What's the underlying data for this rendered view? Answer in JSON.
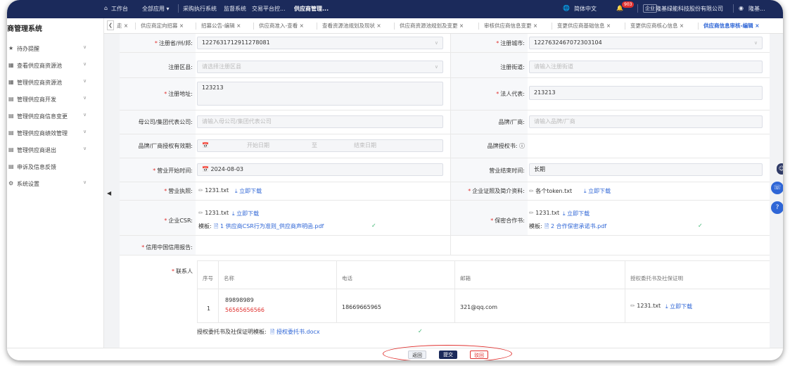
{
  "topbar": {
    "workbench": "工作台",
    "all_apps": "全部应用 ▾",
    "links": [
      "采购执行系统",
      "监督系统",
      "交易平台控...",
      "供应商管理..."
    ],
    "language": "简体中文",
    "notif_count": "903",
    "enterprise_tag": "企业",
    "company": "隆基绿能科技股份有限公司",
    "user": "隆基..."
  },
  "sidebar": {
    "system_title": "商管理系统",
    "items": [
      {
        "icon": "待",
        "label": "待办提醒"
      },
      {
        "icon": "查",
        "label": "查看供应商资源池"
      },
      {
        "icon": "管",
        "label": "管理供应商资源池"
      },
      {
        "icon": "开",
        "label": "管理供应商开发"
      },
      {
        "icon": "变",
        "label": "管理供应商信息变更"
      },
      {
        "icon": "绩",
        "label": "管理供应商绩效管理"
      },
      {
        "icon": "退",
        "label": "管理供应商退出"
      },
      {
        "icon": "诉",
        "label": "申诉及信息反馈"
      },
      {
        "icon": "设",
        "label": "系统设置"
      }
    ]
  },
  "tabs": [
    "走 ×",
    "供应商定向招募 ×",
    "招募公告-编辑 ×",
    "供应商准入-查看 ×",
    "查看资源池规划及现状 ×",
    "供应商资源池规划及变更 ×",
    "审核供应商信息变更 ×",
    "变更供应商基础信息 ×",
    "变更供应商核心信息 ×",
    "供应商信息审核-编辑 ×"
  ],
  "form": {
    "reg_province_label": "注册省/州/邦:",
    "reg_province_value": "1227631712911278081",
    "reg_city_label": "注册城市:",
    "reg_city_value": "1227632467072303104",
    "reg_district_label": "注册区县:",
    "reg_district_placeholder": "请选择注册区县",
    "reg_street_label": "注册街道:",
    "reg_street_placeholder": "请输入注册街道",
    "reg_address_label": "注册地址:",
    "reg_address_value": "123213",
    "legal_rep_label": "法人代表:",
    "legal_rep_value": "213213",
    "parent_rep_label": "母公司/集团代表公司:",
    "parent_rep_placeholder": "请输入母公司/集团代表公司",
    "brand_label": "品牌/厂商:",
    "brand_placeholder": "请输入品牌/厂商",
    "brand_auth_label": "品牌/厂商授权有效期:",
    "start_date_placeholder": "开始日期",
    "to_text": "至",
    "end_date_placeholder": "结束日期",
    "brand_auth_doc_label": "品牌授权书:",
    "biz_start_label": "营业开始时间:",
    "biz_start_value": "2024-08-03",
    "biz_end_label": "营业结束时间:",
    "biz_end_value": "长期",
    "license_label": "营业执照:",
    "license_file": "1231.txt",
    "download": "立即下载",
    "cert_label": "企业证照及简介资料:",
    "cert_file": "各个token.txt",
    "csr_label": "企业CSR:",
    "csr_file": "1231.txt",
    "template_label": "模板:",
    "csr_template": "1 供应商CSR行为准则_供应商声明函.pdf",
    "nda_label": "保密合作书:",
    "nda_file": "1231.txt",
    "nda_template": "2 合作保密承诺书.pdf",
    "credit_label": "信用中国信用报告:",
    "contact_label": "联系人",
    "contacts_headers": [
      "序号",
      "名称",
      "电话",
      "邮箱",
      "授权委托书及社保证明"
    ],
    "contacts_rows": [
      {
        "no": "1",
        "name": "89898989",
        "name2": "56565656566",
        "phone": "18669665965",
        "email": "321@qq.com",
        "file": "1231.txt",
        "download": "立即下载"
      }
    ],
    "auth_template_label": "授权委托书及社保证明模板:",
    "auth_template_file": "授权委托书.docx"
  },
  "buttons": {
    "back": "返回",
    "submit": "提交",
    "reject": "驳回"
  },
  "colors": {
    "topbar": "#1b2a5b",
    "accent": "#2f66d6",
    "danger": "#e0312f",
    "success": "#35b36b"
  }
}
